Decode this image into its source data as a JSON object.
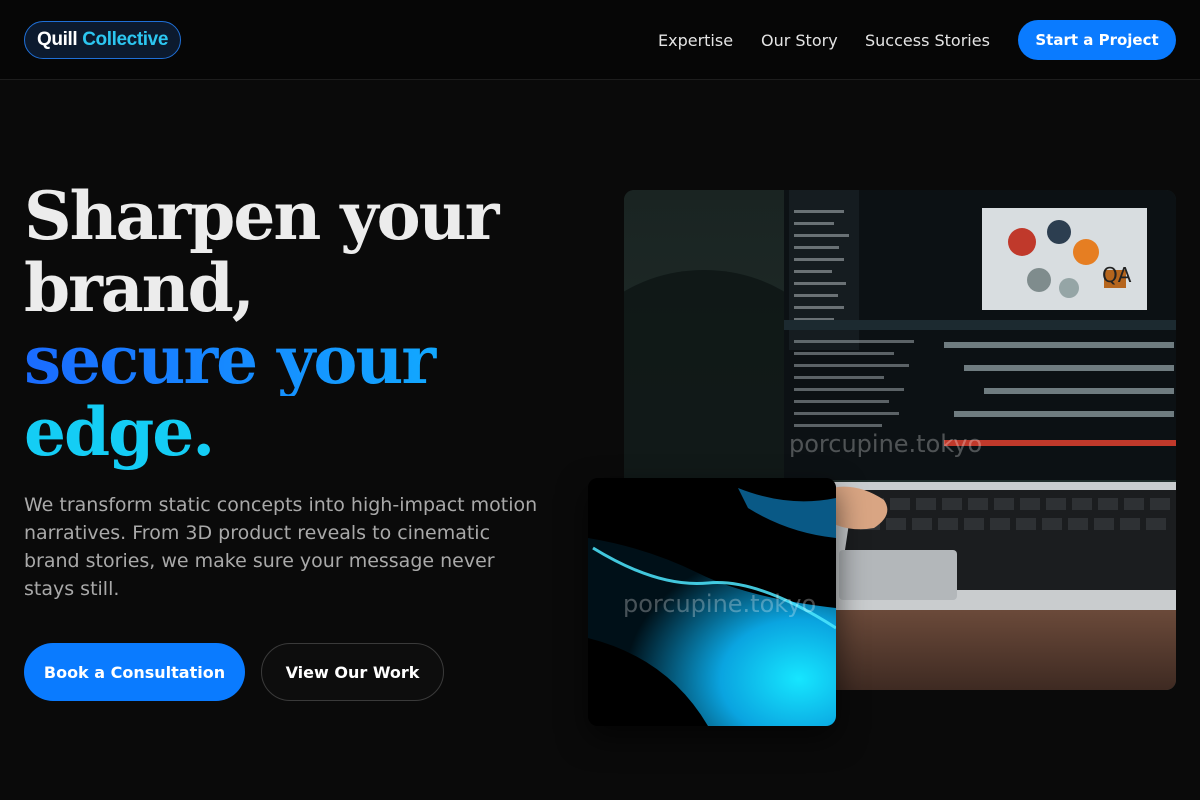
{
  "header": {
    "logo": {
      "part1": "Quill",
      "part2": "Collective"
    },
    "nav": [
      {
        "label": "Expertise"
      },
      {
        "label": "Our Story"
      },
      {
        "label": "Success Stories"
      }
    ],
    "cta_label": "Start a Project"
  },
  "hero": {
    "headline_line1": "Sharpen your",
    "headline_line2": "brand,",
    "headline_line3": "secure your",
    "headline_line4": "edge.",
    "subtext": "We transform static concepts into high-impact motion narratives. From 3D product reveals to cinematic brand stories, we make sure your message never stays still.",
    "primary_button": "Book a Consultation",
    "secondary_button": "View Our Work"
  },
  "images": {
    "main_watermark": "porcupine.tokyo",
    "small_watermark": "porcupine.tokyo"
  },
  "colors": {
    "accent": "#0a7bff",
    "accent_cyan": "#14cdf5",
    "background": "#0a0a0a"
  }
}
